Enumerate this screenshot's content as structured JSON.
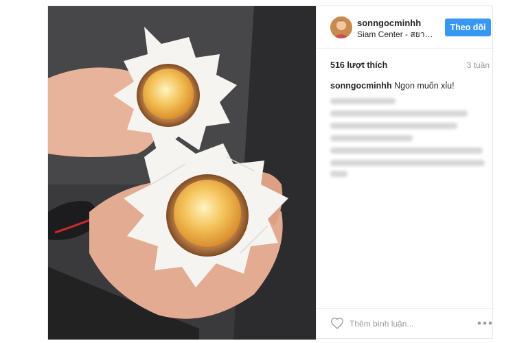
{
  "post": {
    "author": {
      "username": "sonngocminhh",
      "location": "Siam Center - สยาม เซ็นเตอร์"
    },
    "follow_label": "Theo dõi",
    "likes": "516 lượt thích",
    "age": "3 tuần",
    "caption": {
      "username": "sonngocminhh",
      "text": "Ngon muốn xỉu!"
    },
    "comment_placeholder": "Thêm bình luận...",
    "icons": {
      "like": "heart-icon",
      "options": "more-options-icon"
    }
  }
}
